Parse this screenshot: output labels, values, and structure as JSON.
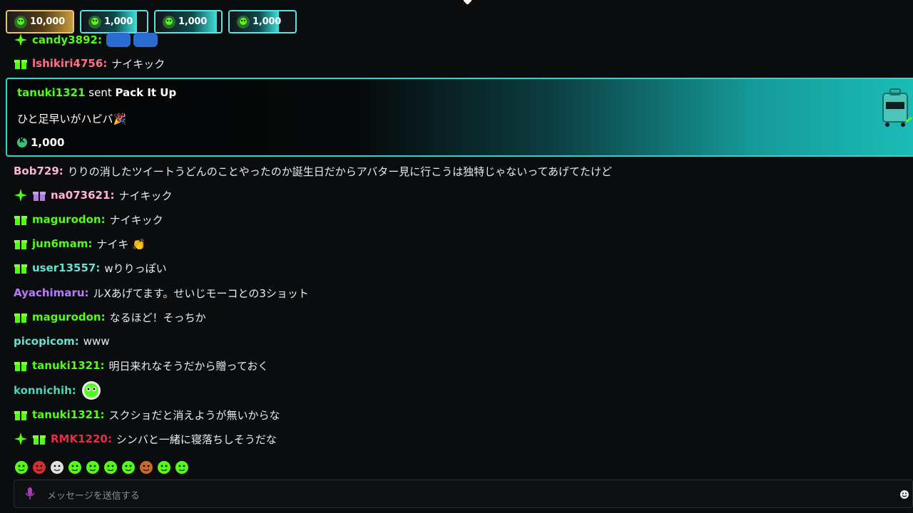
{
  "pinned_gifts": [
    {
      "amount": "10,000",
      "style": "gold",
      "progress": 1.0
    },
    {
      "amount": "1,000",
      "style": "cyan",
      "progress": 0.85
    },
    {
      "amount": "1,000",
      "style": "cyan",
      "progress": 0.93
    },
    {
      "amount": "1,000",
      "style": "cyan",
      "progress": 0.75
    }
  ],
  "partial_row": {
    "user": "candy3892"
  },
  "messages_top": [
    {
      "user": "lshikiri4756",
      "color": "#ff6f8a",
      "text": "ナイキック"
    }
  ],
  "gift_card": {
    "user": "tanuki1321",
    "sent": "sent",
    "item": "Pack It Up",
    "message": "ひと足早いがハピバ🎉",
    "amount": "1,000"
  },
  "messages": [
    {
      "user": "Bob729",
      "color": "#f5b8d4",
      "text": "りりの消したツイートうどんのことやったのか誕生日だからアバター見に行こうは独特じゃないってあげてたけど",
      "badges": []
    },
    {
      "user": "na073621",
      "color": "#ffb3d9",
      "text": "ナイキック",
      "badges": [
        "sparkle",
        "gift-purple"
      ]
    },
    {
      "user": "magurodon",
      "color": "#53fc18",
      "text": "ナイキック",
      "badges": [
        "gift"
      ]
    },
    {
      "user": "jun6mam",
      "color": "#53fc18",
      "text": "ナイキ 👏",
      "badges": [
        "gift"
      ]
    },
    {
      "user": "user13557",
      "color": "#66e0d0",
      "text": "wりりっぽい",
      "badges": [
        "gift"
      ]
    },
    {
      "user": "Ayachimaru",
      "color": "#b67bff",
      "text": "ルXあげてます。せいじモーコとの3ショット",
      "badges": []
    },
    {
      "user": "magurodon",
      "color": "#53fc18",
      "text": "なるほど！そっちか",
      "badges": [
        "gift"
      ]
    },
    {
      "user": "picopicom",
      "color": "#66e0d0",
      "text": "www",
      "badges": []
    },
    {
      "user": "tanuki1321",
      "color": "#53fc18",
      "text": "明日来れなそうだから贈っておく",
      "badges": [
        "gift"
      ]
    },
    {
      "user": "konnichih",
      "color": "#4fd2b5",
      "text": "",
      "badges": []
    },
    {
      "user": "tanuki1321",
      "color": "#53fc18",
      "text": "スクショだと消えようが無いからな",
      "badges": [
        "gift"
      ]
    },
    {
      "user": "RMK1220",
      "color": "#e0304a",
      "text": "シンバと一緒に寝落ちしそうだな",
      "badges": [
        "sparkle",
        "gift"
      ]
    }
  ],
  "input": {
    "placeholder": "メッセージを送信する"
  },
  "colors": {
    "kick_green": "#53fc18",
    "accent_cyan": "#2fd6d0",
    "background": "#0b0c0d"
  }
}
